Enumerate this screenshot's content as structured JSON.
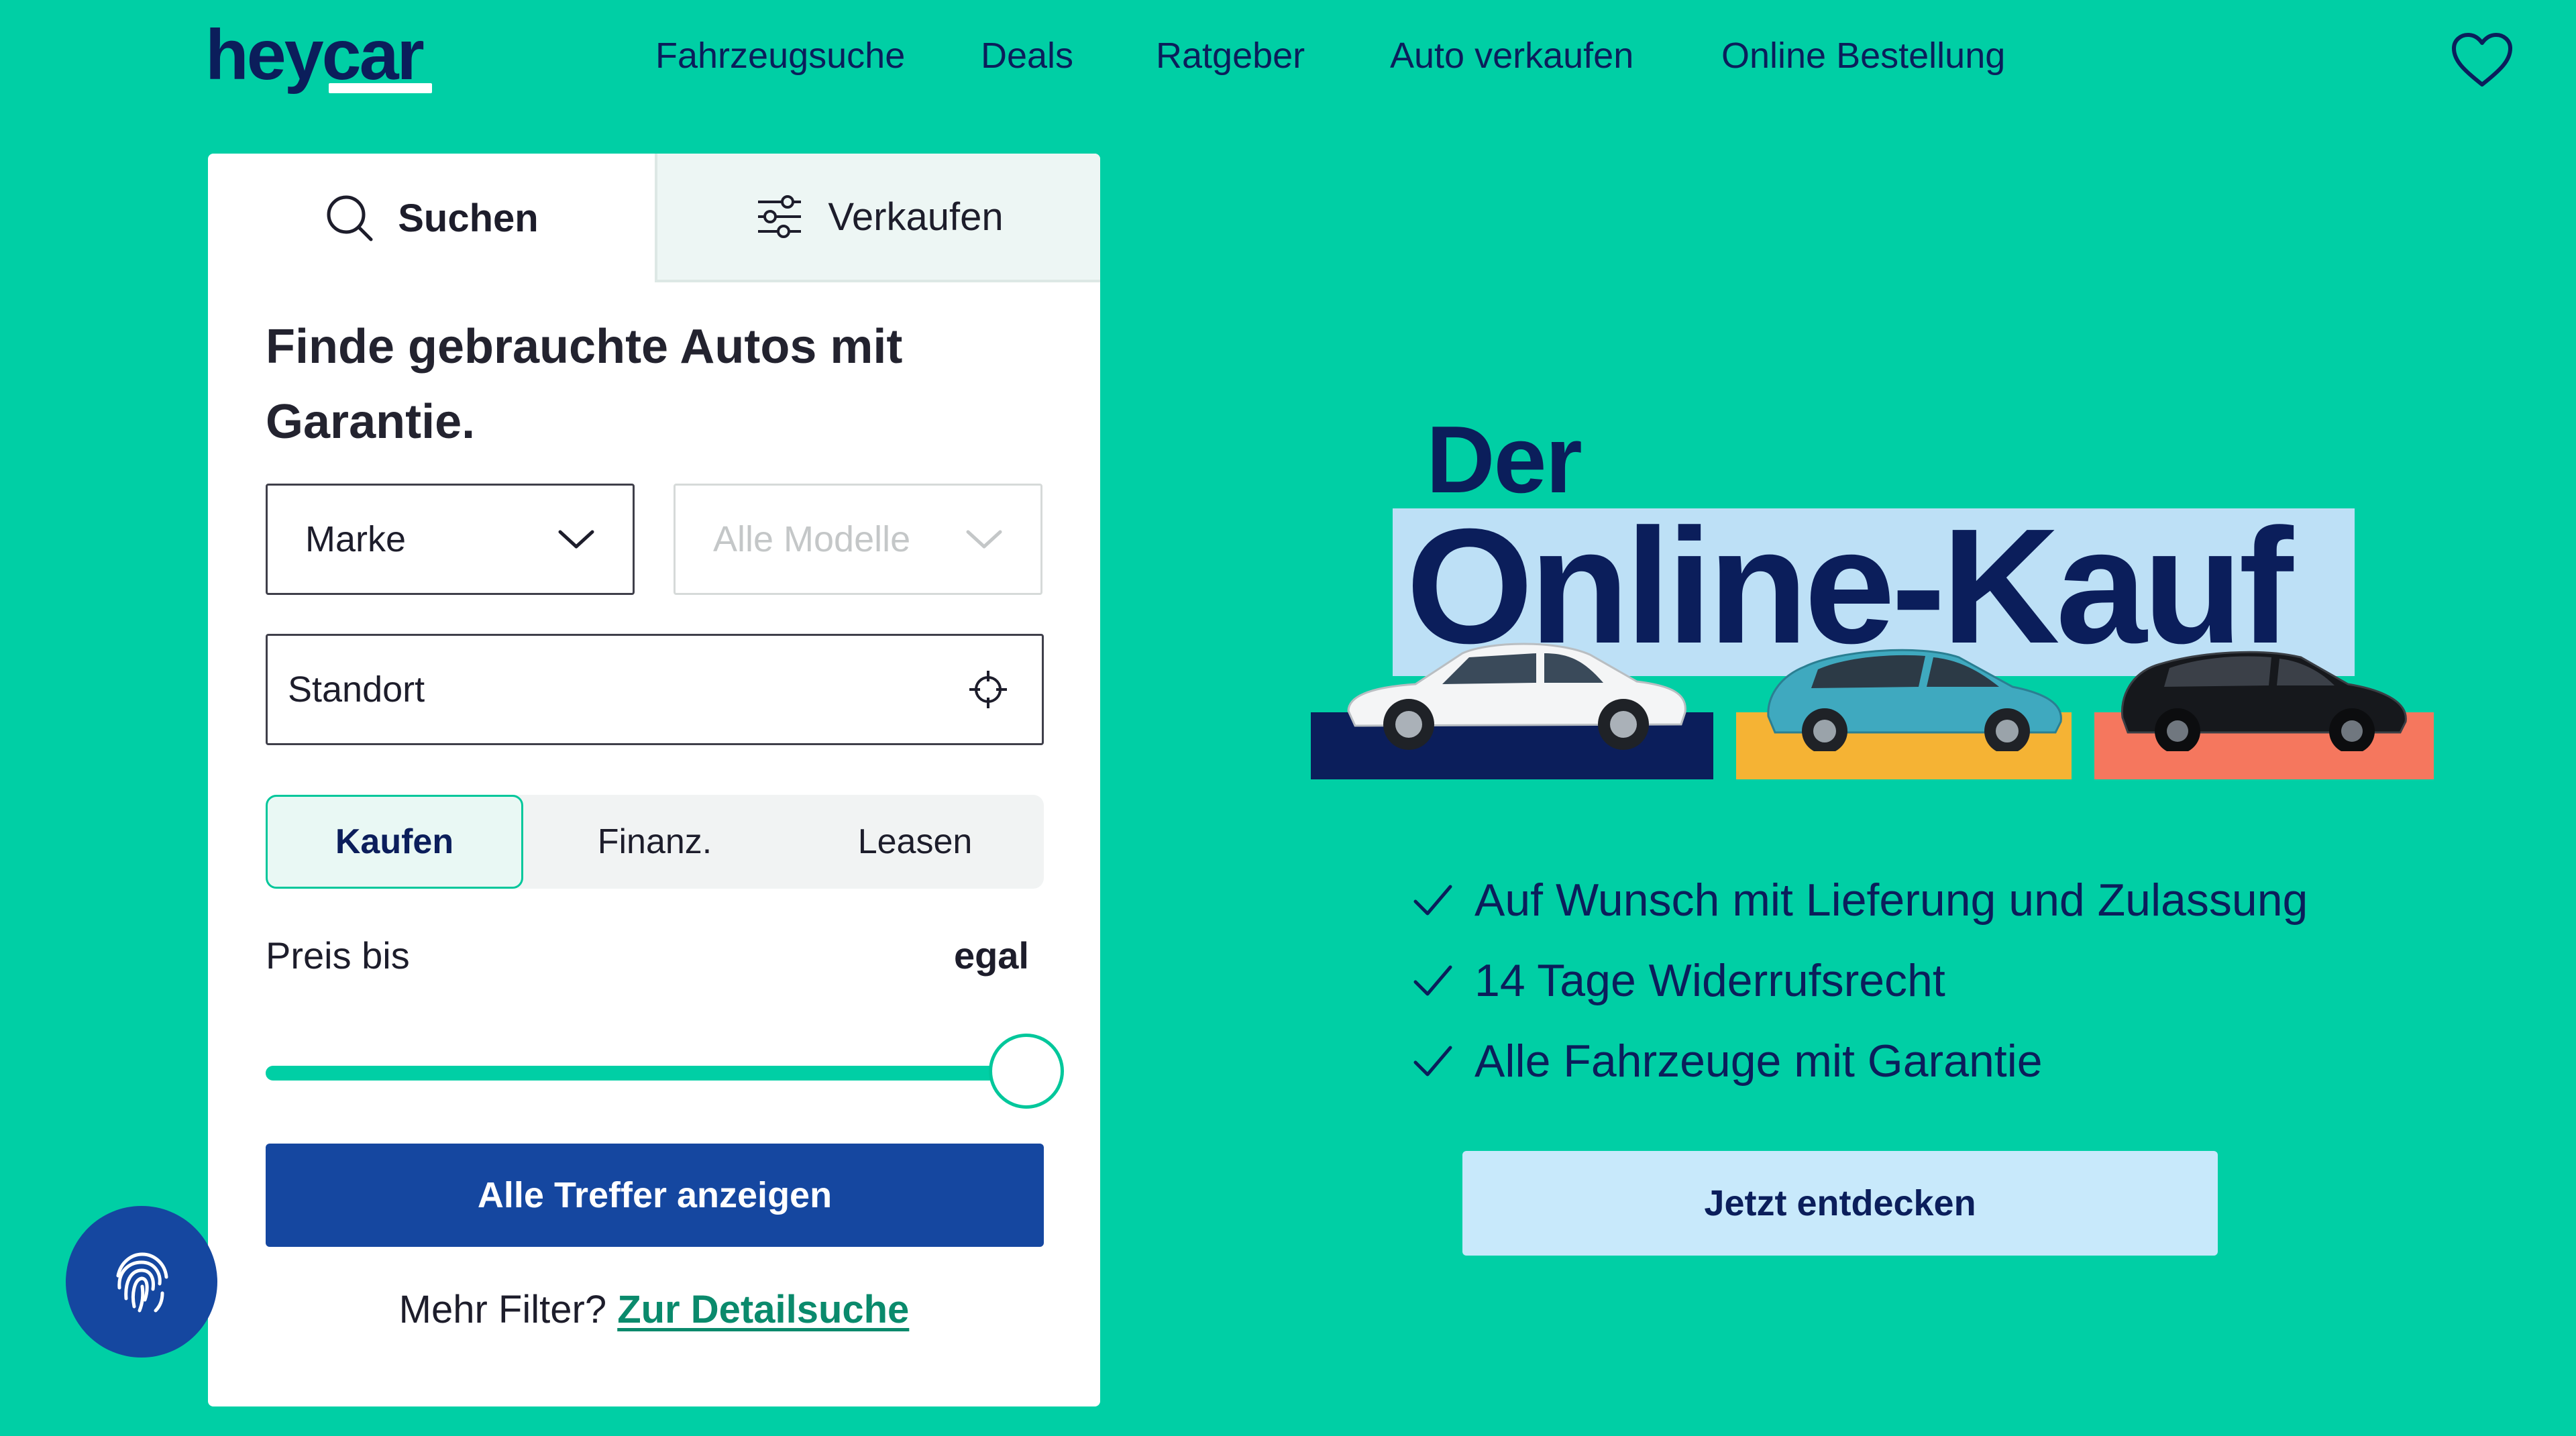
{
  "header": {
    "logo": "heycar",
    "nav": [
      "Fahrzeugsuche",
      "Deals",
      "Ratgeber",
      "Auto verkaufen",
      "Online Bestellung"
    ]
  },
  "search_card": {
    "tabs": {
      "search": "Suchen",
      "sell": "Verkaufen"
    },
    "title": "Finde gebrauchte Autos mit Garantie.",
    "brand_select": {
      "value": "Marke"
    },
    "model_select": {
      "value": "Alle Modelle"
    },
    "location_field": {
      "value": "Standort"
    },
    "purchase_modes": {
      "buy": "Kaufen",
      "finance": "Finanz.",
      "lease": "Leasen",
      "selected": "Kaufen"
    },
    "price": {
      "label": "Preis bis",
      "value": "egal",
      "slider_fraction": 1.0
    },
    "results_button": "Alle Treffer anzeigen",
    "more_filter": {
      "text": "Mehr Filter?",
      "link": "Zur Detailsuche"
    }
  },
  "hero": {
    "kicker": "Der",
    "title": "Online-Kauf",
    "benefits": [
      "Auf Wunsch mit Lieferung und Zulassung",
      "14 Tage Widerrufsrecht",
      "Alle Fahrzeuge mit Garantie"
    ],
    "cta": "Jetzt entdecken"
  },
  "colors": {
    "background": "#00cfa5",
    "navy": "#0b1e5b",
    "primary_button": "#1547a0",
    "highlight": "#bde0f6",
    "car_box_1": "#0b1e5b",
    "car_box_2": "#f5b334",
    "car_box_3": "#f5775e"
  },
  "icons": {
    "favorites": "heart-icon",
    "search_tab": "search-icon",
    "sell_tab": "sliders-icon",
    "model_dropdown": "chevron-down-icon",
    "location": "crosshair-icon",
    "badge": "fingerprint-icon",
    "benefit": "check-icon"
  }
}
